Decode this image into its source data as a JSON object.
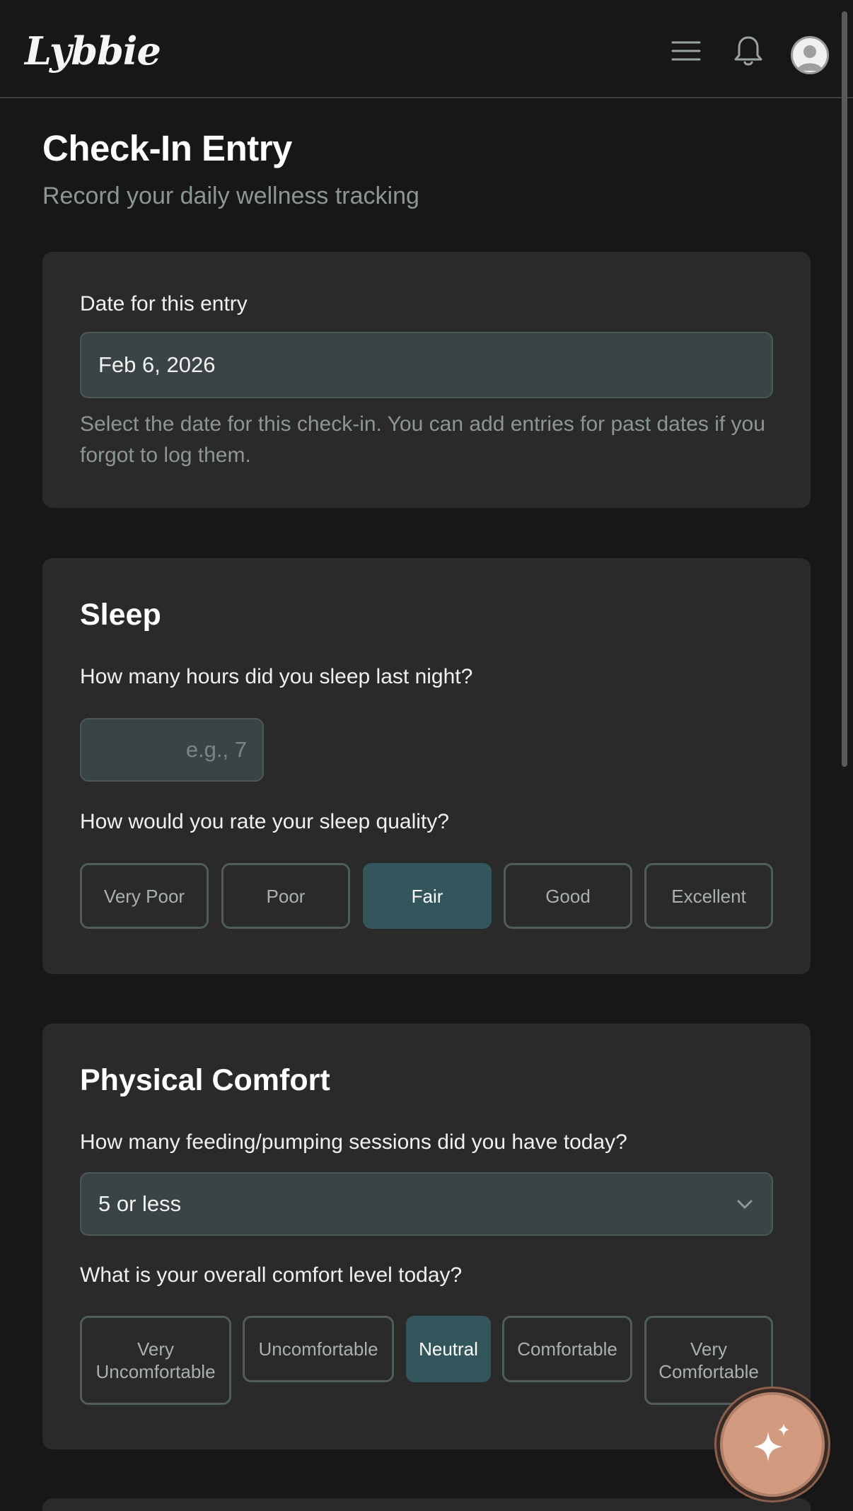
{
  "header": {
    "logo": "Lybbie",
    "icons": [
      "menu-icon",
      "bell-icon",
      "avatar-icon"
    ]
  },
  "page": {
    "title": "Check-In Entry",
    "subtitle": "Record your daily wellness tracking"
  },
  "date_card": {
    "label": "Date for this entry",
    "value": "Feb 6, 2026",
    "helper": "Select the date for this check-in. You can add entries for past dates if you forgot to log them."
  },
  "sleep": {
    "title": "Sleep",
    "hours_question": "How many hours did you sleep last night?",
    "hours_placeholder": "e.g., 7",
    "quality_question": "How would you rate your sleep quality?",
    "quality_options": [
      "Very Poor",
      "Poor",
      "Fair",
      "Good",
      "Excellent"
    ],
    "quality_selected": "Fair"
  },
  "comfort": {
    "title": "Physical Comfort",
    "sessions_question": "How many feeding/pumping sessions did you have today?",
    "sessions_value": "5 or less",
    "level_question": "What is your overall comfort level today?",
    "level_options": [
      "Very Uncomfortable",
      "Uncomfortable",
      "Neutral",
      "Comfortable",
      "Very Comfortable"
    ],
    "level_selected": "Neutral"
  },
  "fab": {
    "icon": "sparkle-icon"
  },
  "colors": {
    "background": "#171717",
    "card": "#2a2a2a",
    "input": "#3a4445",
    "accent": "#33565c",
    "fab": "#d29b7f"
  }
}
